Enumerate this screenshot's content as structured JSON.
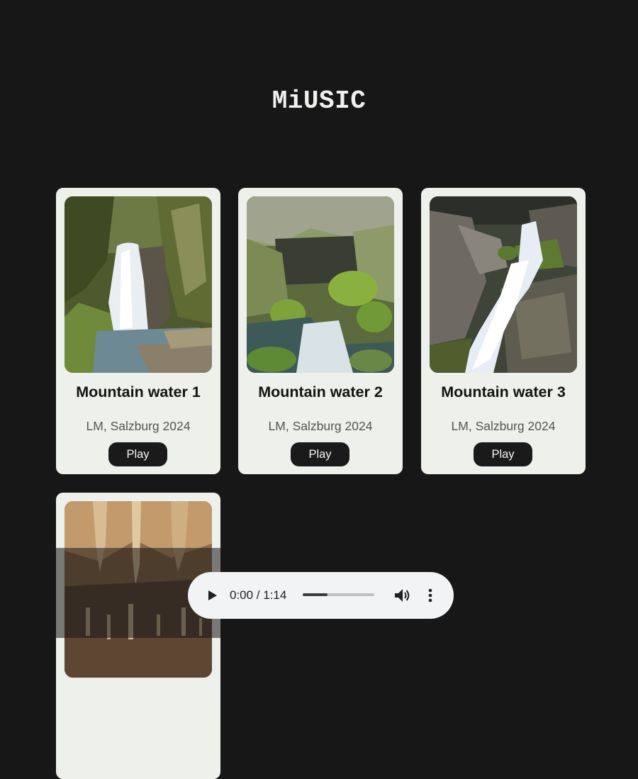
{
  "site": {
    "title": "MiUSIC"
  },
  "tracks": [
    {
      "title": "Mountain water 1",
      "meta": "LM, Salzburg 2024",
      "play_label": "Play",
      "image": "waterfall-forest"
    },
    {
      "title": "Mountain water 2",
      "meta": "LM, Salzburg 2024",
      "play_label": "Play",
      "image": "mossy-rocks-stream"
    },
    {
      "title": "Mountain water 3",
      "meta": "LM, Salzburg 2024",
      "play_label": "Play",
      "image": "rocky-cascade"
    },
    {
      "image": "cave-stalagmites"
    }
  ],
  "player": {
    "time": "0:00 / 1:14",
    "progress": 0.35,
    "icons": {
      "play": "play-icon",
      "volume": "volume-icon",
      "menu": "more-vertical-icon"
    }
  },
  "colors": {
    "background": "#181718",
    "card": "#eef0ec",
    "button": "#1b1a1b",
    "player": "#f1f3f4"
  }
}
